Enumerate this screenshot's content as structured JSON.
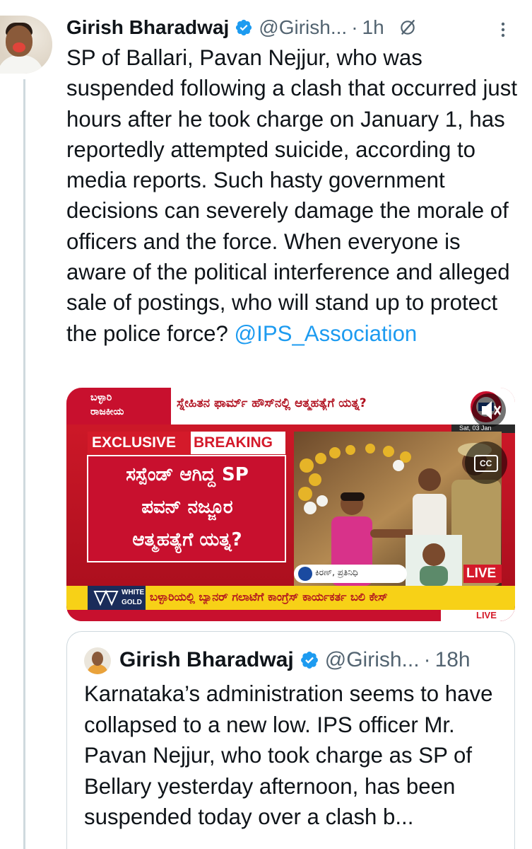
{
  "tweet": {
    "author_name": "Girish Bharadwaj",
    "handle": "@Girish...",
    "dot": "·",
    "time": "1h",
    "text": "SP of Ballari, Pavan Nejjur, who was suspended following a clash that occurred just hours after he took charge on January 1, has reportedly attempted suicide, according to media reports. Such hasty government decisions can severely damage the morale of officers and the force. When everyone is aware of the political interference and alleged sale of postings, who will stand up to protect the police force? ",
    "mention": "@IPS_Association"
  },
  "media": {
    "top_logo_line1": "ಬಳ್ಳಾರಿ",
    "top_logo_line2": "ರಾಜಕೀಯ",
    "top_headline": "ಸ್ನೇಹಿತನ ಫಾರ್ಮ್ ಹೌಸ್‌ನಲ್ಲಿ ಆತ್ಮಹತ್ಯೆಗೆ ಯತ್ನ?",
    "date_text": "Sat, 03 Jan",
    "exclusive_label": "EXCLUSIVE",
    "breaking_label": "BREAKING",
    "main_headline_1": "ಸಸ್ಪೆಂಡ್ ಆಗಿದ್ದ SP",
    "main_headline_2": "ಪವನ್ ನಜ್ಜೂರ",
    "main_headline_3": "ಆತ್ಮಹತ್ಯೆಗೆ ಯತ್ನ?",
    "reporter": "ಕಿರಣ್, ಪ್ರತಿನಿಧಿ",
    "live_label": "LIVE",
    "sponsor_line1": "WHITE",
    "sponsor_line2": "GOLD",
    "bottom_ticker": "ಬಳ್ಳಾರಿಯಲ್ಲಿ ಬ್ಯಾನರ್ ಗಲಾಟೆಗೆ ಕಾಂಗ್ರೆಸ್ ಕಾರ್ಯಕರ್ತ ಬಲಿ ಕೇಸ್",
    "bottom_live_label": "LIVE",
    "cc_label": "CC"
  },
  "quote": {
    "author_name": "Girish Bharadwaj",
    "handle": "@Girish...",
    "dot": "·",
    "time": "18h",
    "text": "Karnataka’s administration seems to have collapsed to a new low. IPS officer Mr. Pavan Nejjur, who took charge as SP of Bellary yesterday afternoon, has been suspended today over a clash b..."
  },
  "colors": {
    "link": "#1d9bf0",
    "verified": "#1d9bf0",
    "secondary_text": "#536471",
    "channel_red": "#c8102e",
    "banner_yellow": "#f7d117"
  },
  "icons": [
    "verified-badge-icon",
    "grok-icon",
    "more-options-icon",
    "mute-icon",
    "closed-captions-icon"
  ]
}
